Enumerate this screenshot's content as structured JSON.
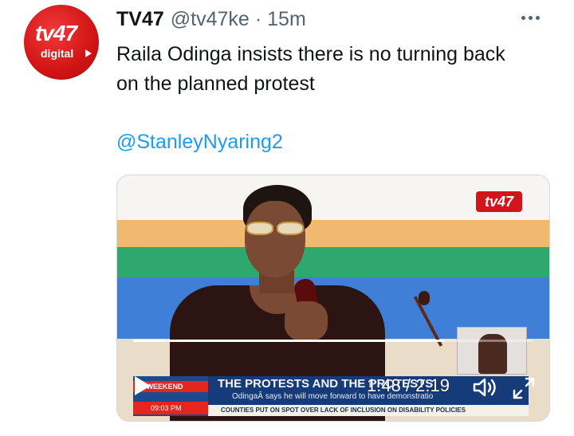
{
  "avatar": {
    "logo_main": "tv47",
    "logo_sub": "digital"
  },
  "tweet": {
    "display_name": "TV47",
    "handle": "@tv47ke",
    "separator": "·",
    "timestamp": "15m",
    "text": "Raila Odinga insists there is no turning back on the planned protest",
    "mention": "@StanleyNyaring2"
  },
  "video": {
    "channel_logo": "tv47",
    "ticker_segment": "47 WEEKEND",
    "ticker_clock": "09:03 PM",
    "headline": "THE PROTESTS AND THE PROTESTS",
    "subheadline": "OdingaÂ says he will move forward to have demonstratio",
    "bottom_strip": "COUNTIES PUT ON SPOT OVER LACK OF INCLUSION ON DISABILITY POLICIES",
    "current_time": "1:48",
    "duration": "2:19",
    "time_label": "1:48 / 2:19",
    "progress_fraction": 0.777
  },
  "icons": {
    "more": "more-dots-icon",
    "volume": "volume-icon",
    "expand": "expand-icon",
    "play": "play-icon"
  },
  "colors": {
    "link": "#1d9bf0",
    "secondary_text": "#536471",
    "avatar_red": "#d11414"
  }
}
